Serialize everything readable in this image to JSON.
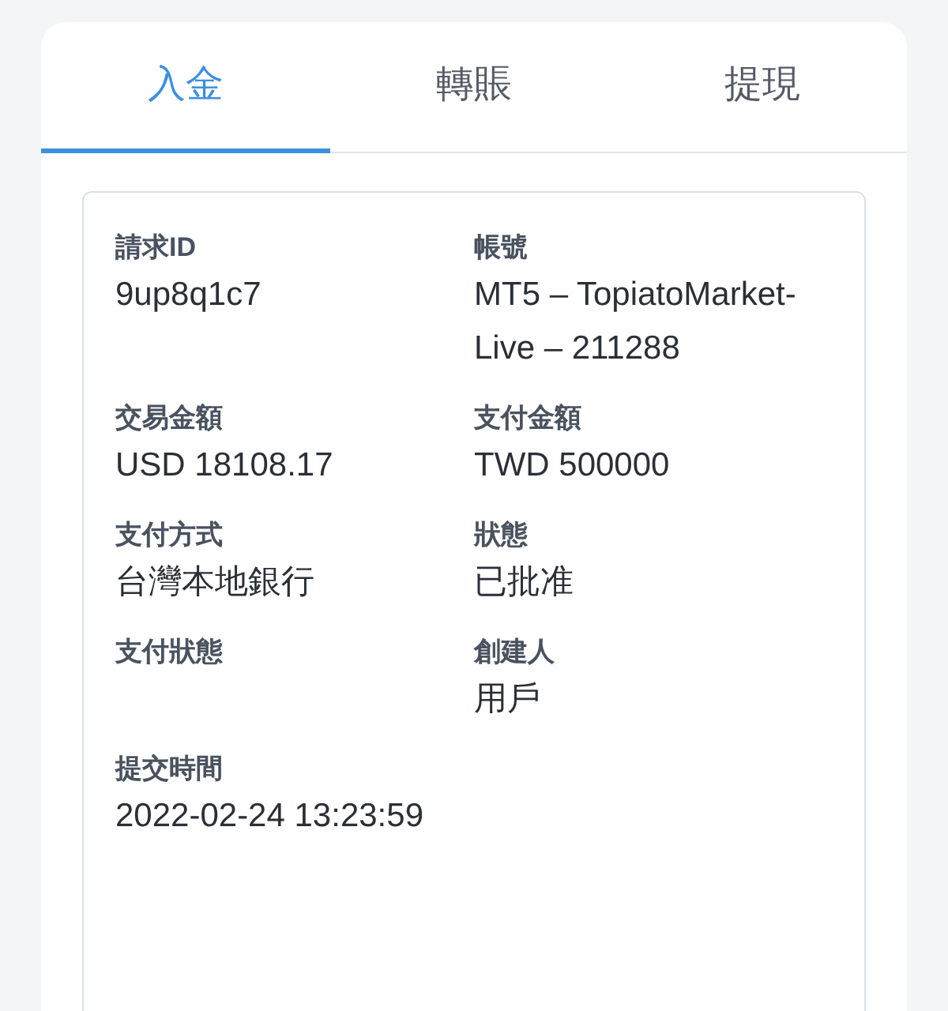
{
  "tabs": [
    {
      "label": "入金",
      "selected": true
    },
    {
      "label": "轉賬",
      "selected": false
    },
    {
      "label": "提現",
      "selected": false
    }
  ],
  "details": [
    {
      "label": "請求ID",
      "value": "9up8q1c7"
    },
    {
      "label": "帳號",
      "value": "MT5 – TopiatoMarket-Live – 211288"
    },
    {
      "label": "交易金額",
      "value": "USD 18108.17"
    },
    {
      "label": "支付金額",
      "value": "TWD 500000"
    },
    {
      "label": "支付方式",
      "value": "台灣本地銀行"
    },
    {
      "label": "狀態",
      "value": "已批准"
    },
    {
      "label": "支付狀態"
    },
    {
      "label": "創建人",
      "value": "用戶"
    },
    {
      "label": "提交時間",
      "value": "2022-02-24 13:23:59"
    }
  ]
}
